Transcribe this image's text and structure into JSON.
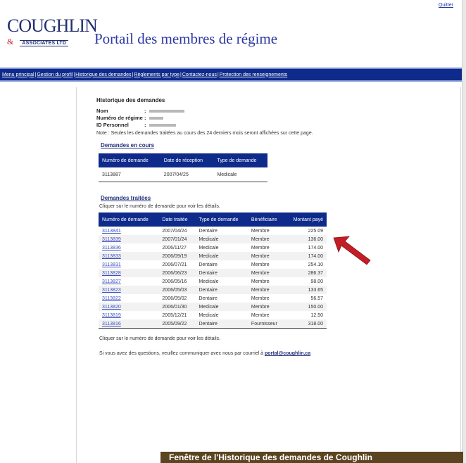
{
  "header": {
    "quit_label": "Quitter",
    "logo_word": "COUGHLIN",
    "logo_amp": "&",
    "logo_sub": "ASSOCIATES LTD",
    "portal_title": "Portail des membres de régime"
  },
  "nav": {
    "items": [
      "Menu principal",
      "Gestion du profil",
      "Historique des demandes",
      "Règlements par type",
      "Contactez-nous",
      "Protection des renseignements"
    ]
  },
  "main": {
    "heading": "Historique des demandes",
    "fields": {
      "name_label": "Nom",
      "plan_label": "Numéro de régime",
      "id_label": "ID Personnel",
      "colon": ":"
    },
    "note": "Note : Seules les demandes traitées au cours des 24 derniers mois seront affichées sur cette page.",
    "pending": {
      "title": "Demandes en cours",
      "headers": [
        "Numéro de demande",
        "Date de réception",
        "Type de demande"
      ],
      "rows": [
        [
          "3113887",
          "2007/04/25",
          "Medicale"
        ]
      ]
    },
    "processed": {
      "title": "Demandes traitées",
      "hint": "Cliquer sur le numéro de demande pour voir les détails.",
      "headers": [
        "Numéro de demande",
        "Date traitée",
        "Type de demande",
        "Bénéficiaire",
        "Montant payé"
      ],
      "rows": [
        [
          "3113841",
          "2007/04/24",
          "Dentaire",
          "Membre",
          "225.09"
        ],
        [
          "3113839",
          "2007/01/24",
          "Medicale",
          "Membre",
          "136.00"
        ],
        [
          "3113836",
          "2006/11/27",
          "Medicale",
          "Membre",
          "174.00"
        ],
        [
          "3113833",
          "2006/09/19",
          "Medicale",
          "Membre",
          "174.00"
        ],
        [
          "3113831",
          "2006/07/21",
          "Dentaire",
          "Membre",
          "254.10"
        ],
        [
          "3113828",
          "2006/06/23",
          "Dentaire",
          "Membre",
          "286.37"
        ],
        [
          "3113827",
          "2006/05/16",
          "Medicale",
          "Membre",
          "98.00"
        ],
        [
          "3113823",
          "2006/05/03",
          "Dentaire",
          "Membre",
          "133.65"
        ],
        [
          "3113822",
          "2006/05/02",
          "Dentaire",
          "Membre",
          "56.57"
        ],
        [
          "3113820",
          "2006/01/30",
          "Medicale",
          "Membre",
          "150.00"
        ],
        [
          "3113819",
          "2005/12/21",
          "Medicale",
          "Membre",
          "12.50"
        ],
        [
          "3113816",
          "2005/09/22",
          "Dentaire",
          "Fournisseur",
          "318.00"
        ]
      ]
    },
    "footer_hint": "Cliquer sur le numéro de demande pour voir les détails.",
    "contact_text": "Si vous avez des questions, veuillez communiquer avec nous par courriel à",
    "contact_email": "portal@coughlin.ca"
  },
  "caption": "Fenêtre de l'Historique des demandes de Coughlin",
  "colors": {
    "nav_bg": "#0e2a8a",
    "title_blue": "#2a37a3",
    "arrow_red": "#c21e25",
    "caption_bg": "#5b4420"
  }
}
